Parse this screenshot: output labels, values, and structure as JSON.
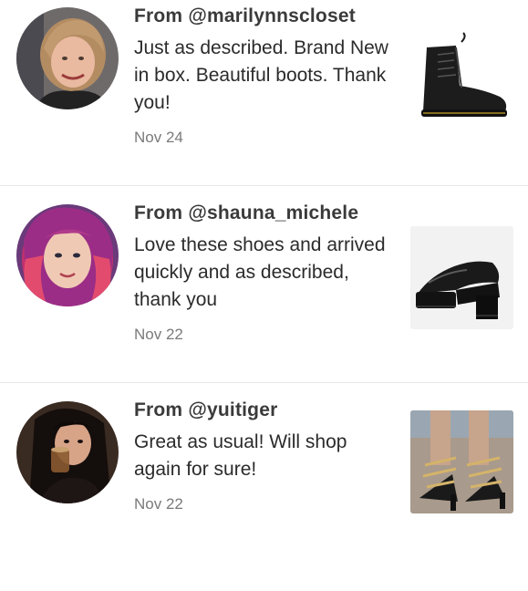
{
  "reviews": [
    {
      "from": "From @marilynnscloset",
      "text": "Just as described. Brand New in box. Beautiful boots. Thank you!",
      "date": "Nov 24",
      "avatar_icon": "avatar-woman-short-blonde-hair",
      "product_icon": "black-lace-up-boot"
    },
    {
      "from": "From @shauna_michele",
      "text": "Love these shoes and arrived quickly and as described, thank you",
      "date": "Nov 22",
      "avatar_icon": "avatar-woman-pink-hair",
      "product_icon": "black-platform-slide-sandal"
    },
    {
      "from": "From @yuitiger",
      "text": "Great as usual! Will shop again for sure!",
      "date": "Nov 22",
      "avatar_icon": "avatar-woman-dark-hair",
      "product_icon": "chain-strap-heeled-sandal"
    }
  ],
  "colors": {
    "handle": "#3a3a3a",
    "body_text": "#2b2b2b",
    "date": "#7a7a7a",
    "divider": "#e8e8e8"
  }
}
